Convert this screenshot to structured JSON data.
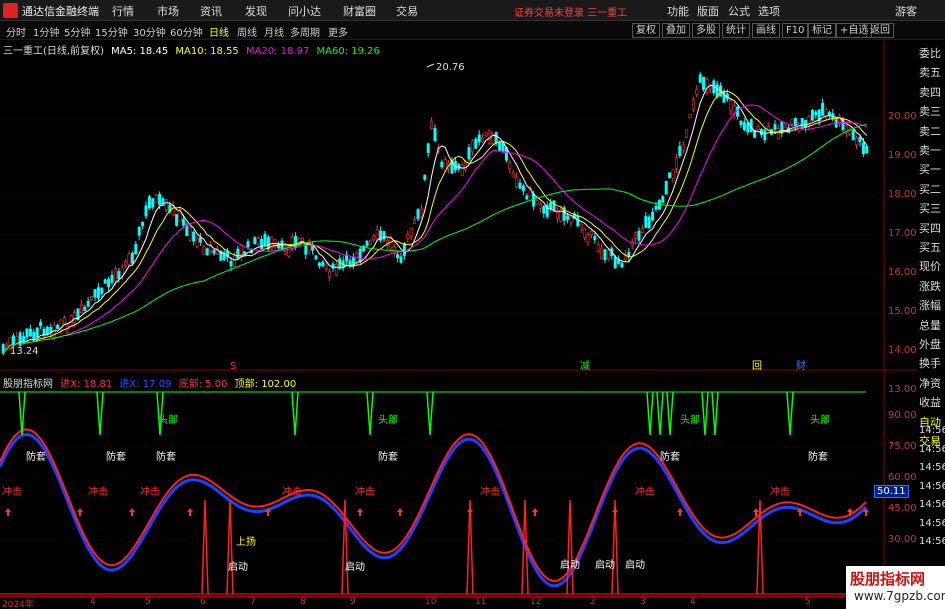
{
  "titlebar": {
    "app_title": "通达信金融终端",
    "menus": [
      "行情",
      "市场",
      "资讯",
      "发现",
      "问小达",
      "财富圈",
      "交易"
    ],
    "login_status": "证券交易未登录  三一重工",
    "right_menus": [
      "功能",
      "版面",
      "公式",
      "选项"
    ],
    "guest": "游客"
  },
  "period_bar": {
    "periods": [
      "分时",
      "1分钟",
      "5分钟",
      "15分钟",
      "30分钟",
      "60分钟",
      "日线",
      "周线",
      "月线",
      "多周期",
      "更多"
    ],
    "active_index": 6,
    "tools": [
      "复权",
      "叠加",
      "多股",
      "统计",
      "画线",
      "F10",
      "标记",
      "+自选",
      "返回"
    ]
  },
  "main_chart": {
    "stock_label": "三一重工(日线,前复权)",
    "ma": [
      {
        "label": "MA5: 18.45",
        "color": "#ffffff"
      },
      {
        "label": "MA10: 18.55",
        "color": "#ffff00"
      },
      {
        "label": "MA20: 18.97",
        "color": "#ff00ff"
      },
      {
        "label": "MA60: 19.26",
        "color": "#00ff00"
      }
    ],
    "y_ticks": [
      "20.00",
      "19.00",
      "18.00",
      "17.00",
      "16.00",
      "15.00",
      "14.00",
      "13.00"
    ],
    "high_label": "20.76",
    "low_label": "13.24",
    "event_marks": [
      "S",
      "减",
      "回",
      "财"
    ]
  },
  "indicator": {
    "name": "股朋指标网",
    "values": [
      {
        "label": "进X: 18.81",
        "color": "#ff3030"
      },
      {
        "label": "进X: 17.09",
        "color": "#3050ff"
      },
      {
        "label": "底部: 5.00",
        "color": "#ff3030"
      },
      {
        "label": "顶部: 102.00",
        "color": "#ffff00"
      }
    ],
    "y_ticks": [
      "90.00",
      "75.00",
      "60.00",
      "45.00",
      "30.00"
    ],
    "current_value": "50.11",
    "labels": [
      "防套",
      "冲击",
      "头部",
      "启动",
      "上扬"
    ]
  },
  "side_panel": {
    "items": [
      "委比",
      "卖五",
      "卖四",
      "卖三",
      "卖二",
      "卖一",
      "买一",
      "买二",
      "买三",
      "买四",
      "买五",
      "现价",
      "涨跌",
      "涨幅",
      "总量",
      "外盘",
      "换手",
      "净资",
      "收益",
      "自动",
      "交易"
    ],
    "times": [
      "14:56",
      "14:56",
      "14:56",
      "14:56",
      "14:56",
      "14:56",
      "14:56"
    ]
  },
  "date_bar": {
    "labels": [
      "2024年",
      "4",
      "5",
      "6",
      "7",
      "8",
      "9",
      "10",
      "11",
      "12",
      "2",
      "3",
      "4",
      "5"
    ]
  },
  "watermark": {
    "line1": "股朋指标网",
    "line2": "www.7gpzb.com"
  },
  "colors": {
    "up": "#ff3030",
    "down": "#00ffff",
    "grid": "#8b0000",
    "ma5": "#ffffff",
    "ma10": "#ffff00",
    "ma20": "#ff00ff",
    "ma60": "#00ff00"
  }
}
